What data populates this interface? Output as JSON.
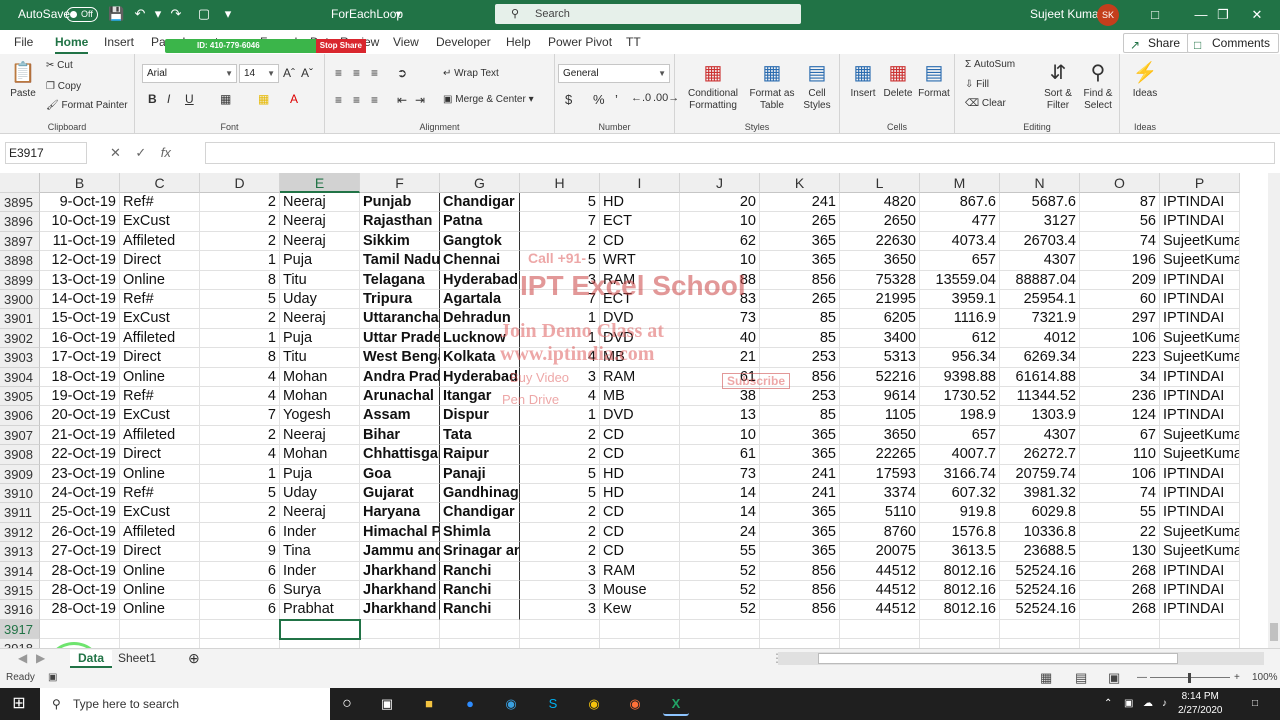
{
  "titlebar": {
    "autosave_label": "AutoSave",
    "autosave_state": "Off",
    "filename": "ForEachLoop",
    "search_placeholder": "Search",
    "user_name": "Sujeet Kumar",
    "user_initials": "SK"
  },
  "overlay": {
    "id_text": "ID: 410-779-6046",
    "stop_share": "Stop Share"
  },
  "tabs": [
    "File",
    "Home",
    "Insert",
    "Page Layout",
    "Formulas",
    "Data",
    "Review",
    "View",
    "Developer",
    "Help",
    "Power Pivot",
    "TT"
  ],
  "share_label": "Share",
  "comments_label": "Comments",
  "ribbon": {
    "clipboard": {
      "paste": "Paste",
      "cut": "Cut",
      "copy": "Copy",
      "format_painter": "Format Painter",
      "label": "Clipboard"
    },
    "font": {
      "name": "Arial",
      "size": "14",
      "bold": "B",
      "italic": "I",
      "underline": "U",
      "label": "Font"
    },
    "alignment": {
      "wrap": "Wrap Text",
      "merge": "Merge & Center",
      "label": "Alignment"
    },
    "number": {
      "format": "General",
      "label": "Number"
    },
    "styles": {
      "conditional": "Conditional Formatting",
      "format_table": "Format as Table",
      "cell_styles": "Cell Styles",
      "label": "Styles"
    },
    "cells": {
      "insert": "Insert",
      "delete": "Delete",
      "format": "Format",
      "label": "Cells"
    },
    "editing": {
      "autosum": "AutoSum",
      "fill": "Fill",
      "clear": "Clear",
      "sort": "Sort & Filter",
      "find": "Find & Select",
      "label": "Editing"
    },
    "ideas": {
      "ideas": "Ideas",
      "label": "Ideas"
    }
  },
  "formula_bar": {
    "name_box": "E3917",
    "fx": "fx",
    "content": ""
  },
  "columns": [
    "B",
    "C",
    "D",
    "E",
    "F",
    "G",
    "H",
    "I",
    "J",
    "K",
    "L",
    "M",
    "N",
    "O",
    "P"
  ],
  "rows": [
    [
      "3895",
      "9-Oct-19",
      "Ref#",
      "2",
      "Neeraj",
      "Punjab",
      "Chandigar",
      "5",
      "HD",
      "20",
      "241",
      "4820",
      "867.6",
      "5687.6",
      "87",
      "IPTINDAI"
    ],
    [
      "3896",
      "10-Oct-19",
      "ExCust",
      "2",
      "Neeraj",
      "Rajasthan",
      "Patna",
      "7",
      "ECT",
      "10",
      "265",
      "2650",
      "477",
      "3127",
      "56",
      "IPTINDAI"
    ],
    [
      "3897",
      "11-Oct-19",
      "Affileted",
      "2",
      "Neeraj",
      "Sikkim",
      "Gangtok",
      "2",
      "CD",
      "62",
      "365",
      "22630",
      "4073.4",
      "26703.4",
      "74",
      "SujeetKumar"
    ],
    [
      "3898",
      "12-Oct-19",
      "Direct",
      "1",
      "Puja",
      "Tamil Nadu",
      "Chennai",
      "5",
      "WRT",
      "10",
      "365",
      "3650",
      "657",
      "4307",
      "196",
      "SujeetKumar"
    ],
    [
      "3899",
      "13-Oct-19",
      "Online",
      "8",
      "Titu",
      "Telagana",
      "Hyderabad",
      "3",
      "RAM",
      "88",
      "856",
      "75328",
      "13559.04",
      "88887.04",
      "209",
      "IPTINDAI"
    ],
    [
      "3900",
      "14-Oct-19",
      "Ref#",
      "5",
      "Uday",
      "Tripura",
      "Agartala",
      "7",
      "ECT",
      "83",
      "265",
      "21995",
      "3959.1",
      "25954.1",
      "60",
      "IPTINDAI"
    ],
    [
      "3901",
      "15-Oct-19",
      "ExCust",
      "2",
      "Neeraj",
      "Uttaranchal",
      "Dehradun",
      "1",
      "DVD",
      "73",
      "85",
      "6205",
      "1116.9",
      "7321.9",
      "297",
      "IPTINDAI"
    ],
    [
      "3902",
      "16-Oct-19",
      "Affileted",
      "1",
      "Puja",
      "Uttar Pradesh",
      "Lucknow",
      "1",
      "DVD",
      "40",
      "85",
      "3400",
      "612",
      "4012",
      "106",
      "SujeetKumar"
    ],
    [
      "3903",
      "17-Oct-19",
      "Direct",
      "8",
      "Titu",
      "West Bengal",
      "Kolkata",
      "4",
      "MB",
      "21",
      "253",
      "5313",
      "956.34",
      "6269.34",
      "223",
      "SujeetKumar"
    ],
    [
      "3904",
      "18-Oct-19",
      "Online",
      "4",
      "Mohan",
      "Andra Pradesh",
      "Hyderabad",
      "3",
      "RAM",
      "61",
      "856",
      "52216",
      "9398.88",
      "61614.88",
      "34",
      "IPTINDAI"
    ],
    [
      "3905",
      "19-Oct-19",
      "Ref#",
      "4",
      "Mohan",
      "Arunachal",
      "Itangar",
      "4",
      "MB",
      "38",
      "253",
      "9614",
      "1730.52",
      "11344.52",
      "236",
      "IPTINDAI"
    ],
    [
      "3906",
      "20-Oct-19",
      "ExCust",
      "7",
      "Yogesh",
      "Assam",
      "Dispur",
      "1",
      "DVD",
      "13",
      "85",
      "1105",
      "198.9",
      "1303.9",
      "124",
      "IPTINDAI"
    ],
    [
      "3907",
      "21-Oct-19",
      "Affileted",
      "2",
      "Neeraj",
      "Bihar",
      "Tata",
      "2",
      "CD",
      "10",
      "365",
      "3650",
      "657",
      "4307",
      "67",
      "SujeetKumar"
    ],
    [
      "3908",
      "22-Oct-19",
      "Direct",
      "4",
      "Mohan",
      "Chhattisgarh",
      "Raipur",
      "2",
      "CD",
      "61",
      "365",
      "22265",
      "4007.7",
      "26272.7",
      "110",
      "SujeetKumar"
    ],
    [
      "3909",
      "23-Oct-19",
      "Online",
      "1",
      "Puja",
      "Goa",
      "Panaji",
      "5",
      "HD",
      "73",
      "241",
      "17593",
      "3166.74",
      "20759.74",
      "106",
      "IPTINDAI"
    ],
    [
      "3910",
      "24-Oct-19",
      "Ref#",
      "5",
      "Uday",
      "Gujarat",
      "Gandhinagar",
      "5",
      "HD",
      "14",
      "241",
      "3374",
      "607.32",
      "3981.32",
      "74",
      "IPTINDAI"
    ],
    [
      "3911",
      "25-Oct-19",
      "ExCust",
      "2",
      "Neeraj",
      "Haryana",
      "Chandigar",
      "2",
      "CD",
      "14",
      "365",
      "5110",
      "919.8",
      "6029.8",
      "55",
      "IPTINDAI"
    ],
    [
      "3912",
      "26-Oct-19",
      "Affileted",
      "6",
      "Inder",
      "Himachal Pradesh",
      "Shimla",
      "2",
      "CD",
      "24",
      "365",
      "8760",
      "1576.8",
      "10336.8",
      "22",
      "SujeetKumar"
    ],
    [
      "3913",
      "27-Oct-19",
      "Direct",
      "9",
      "Tina",
      "Jammu and Kashmir",
      "Srinagar and Jammu",
      "2",
      "CD",
      "55",
      "365",
      "20075",
      "3613.5",
      "23688.5",
      "130",
      "SujeetKumar"
    ],
    [
      "3914",
      "28-Oct-19",
      "Online",
      "6",
      "Inder",
      "Jharkhand",
      "Ranchi",
      "3",
      "RAM",
      "52",
      "856",
      "44512",
      "8012.16",
      "52524.16",
      "268",
      "IPTINDAI"
    ],
    [
      "3915",
      "28-Oct-19",
      "Online",
      "6",
      "Surya",
      "Jharkhand",
      "Ranchi",
      "3",
      "Mouse",
      "52",
      "856",
      "44512",
      "8012.16",
      "52524.16",
      "268",
      "IPTINDAI"
    ],
    [
      "3916",
      "28-Oct-19",
      "Online",
      "6",
      "Prabhat",
      "Jharkhand",
      "Ranchi",
      "3",
      "Kew",
      "52",
      "856",
      "44512",
      "8012.16",
      "52524.16",
      "268",
      "IPTINDAI"
    ],
    [
      "3917",
      "",
      "",
      "",
      "",
      "",
      "",
      "",
      "",
      "",
      "",
      "",
      "",
      "",
      "",
      ""
    ],
    [
      "3918",
      "",
      "",
      "",
      "",
      "",
      "",
      "",
      "",
      "",
      "",
      "",
      "",
      "",
      "",
      ""
    ]
  ],
  "watermark": {
    "l1": "Call +91-",
    "l2": "IPT Excel School",
    "l3": "Join Demo Class at",
    "l4": "www.iptindia.com",
    "l5": "Buy Video",
    "l6": "Pen Drive",
    "l7": "Subscribe"
  },
  "sheets": [
    "Data",
    "Sheet1"
  ],
  "status": {
    "ready": "Ready",
    "zoom": "100%"
  },
  "taskbar": {
    "search_placeholder": "Type here to search",
    "time": "8:14 PM",
    "date": "2/27/2020"
  }
}
